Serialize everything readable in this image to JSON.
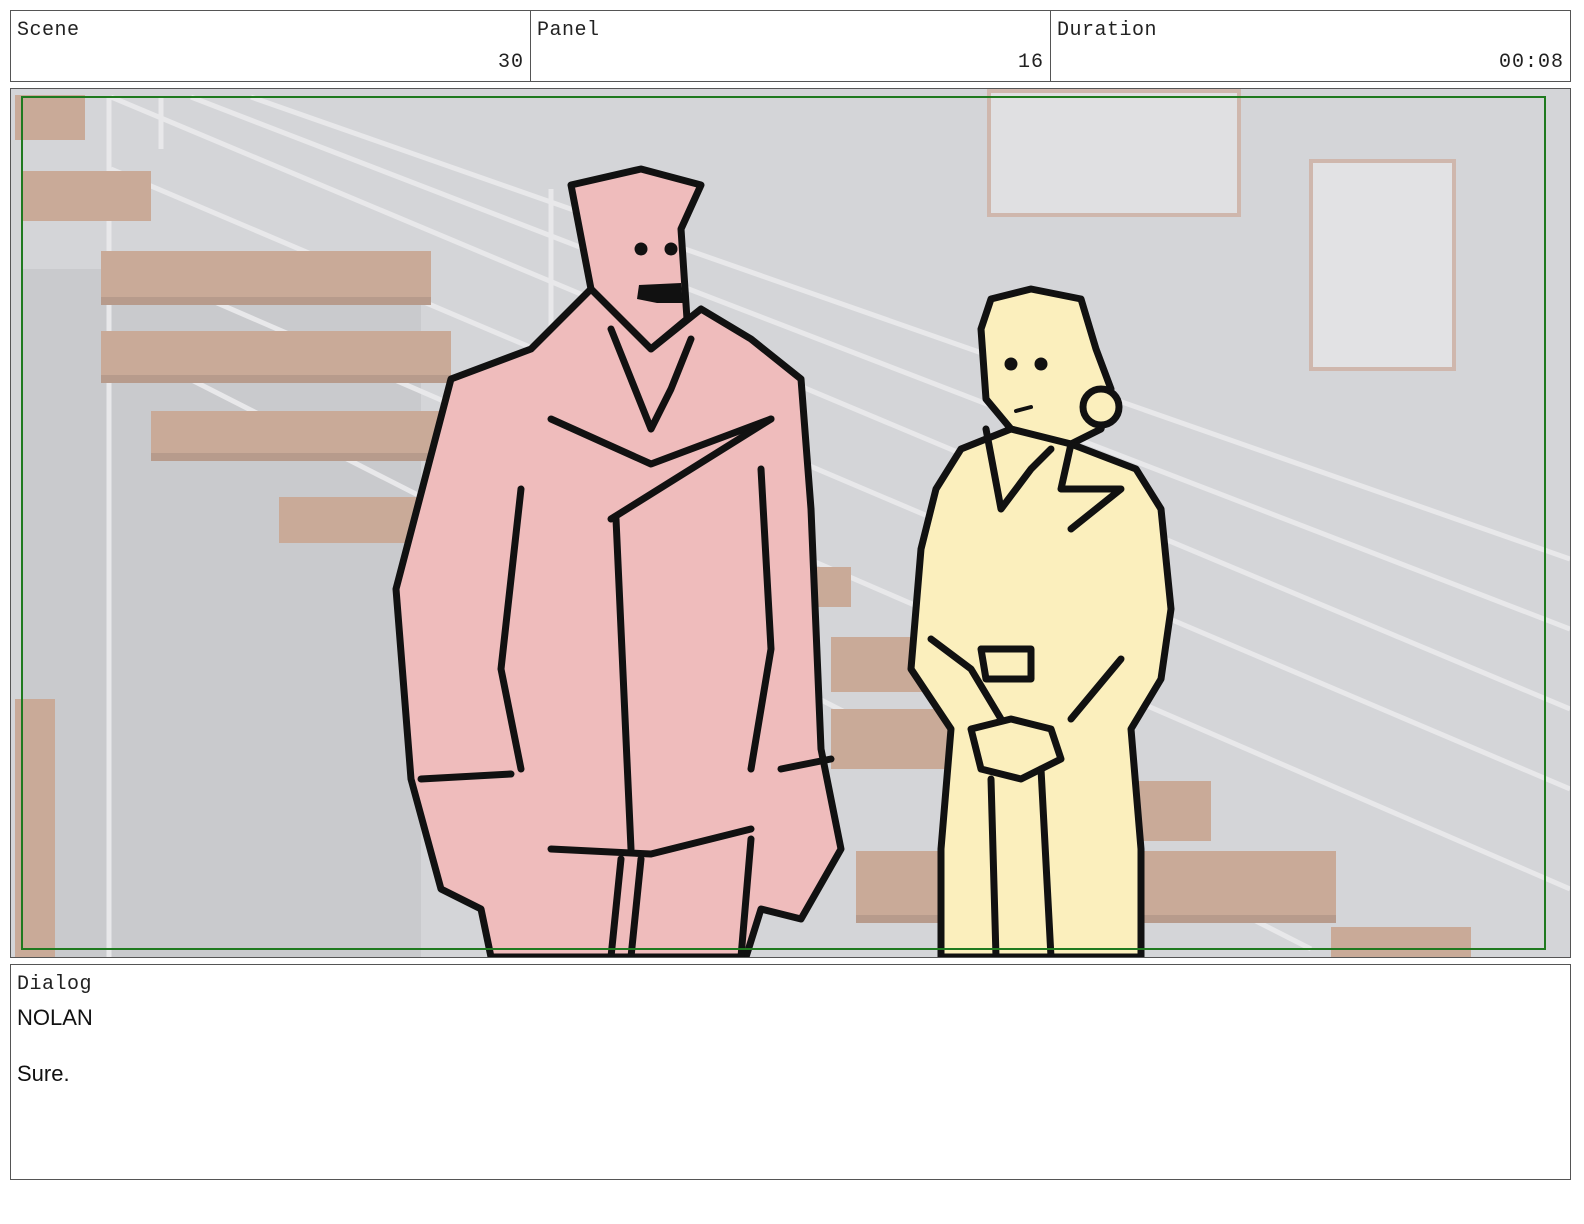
{
  "header": {
    "scene_label": "Scene",
    "scene_value": "30",
    "panel_label": "Panel",
    "panel_value": "16",
    "duration_label": "Duration",
    "duration_value": "00:08"
  },
  "panel_image": {
    "safe_area_color": "#1f7a1f",
    "background_color": "#d4d5d8",
    "stair_color": "#c9aa98",
    "man_fill": "#efbcbc",
    "woman_fill": "#fbefbd"
  },
  "dialog": {
    "label": "Dialog",
    "character": "NOLAN",
    "line": "Sure."
  }
}
